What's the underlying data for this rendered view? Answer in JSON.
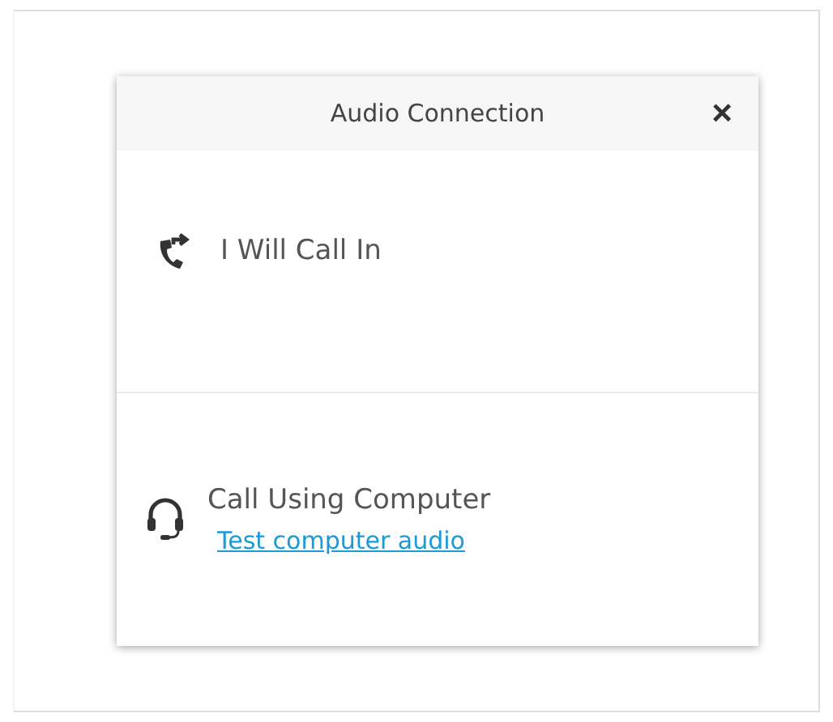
{
  "dialog": {
    "title": "Audio Connection",
    "close": "×"
  },
  "options": [
    {
      "kind": "dial-in",
      "label": "I Will Call In"
    },
    {
      "kind": "computer",
      "label": "Call Using Computer",
      "link": "Test computer audio"
    }
  ]
}
